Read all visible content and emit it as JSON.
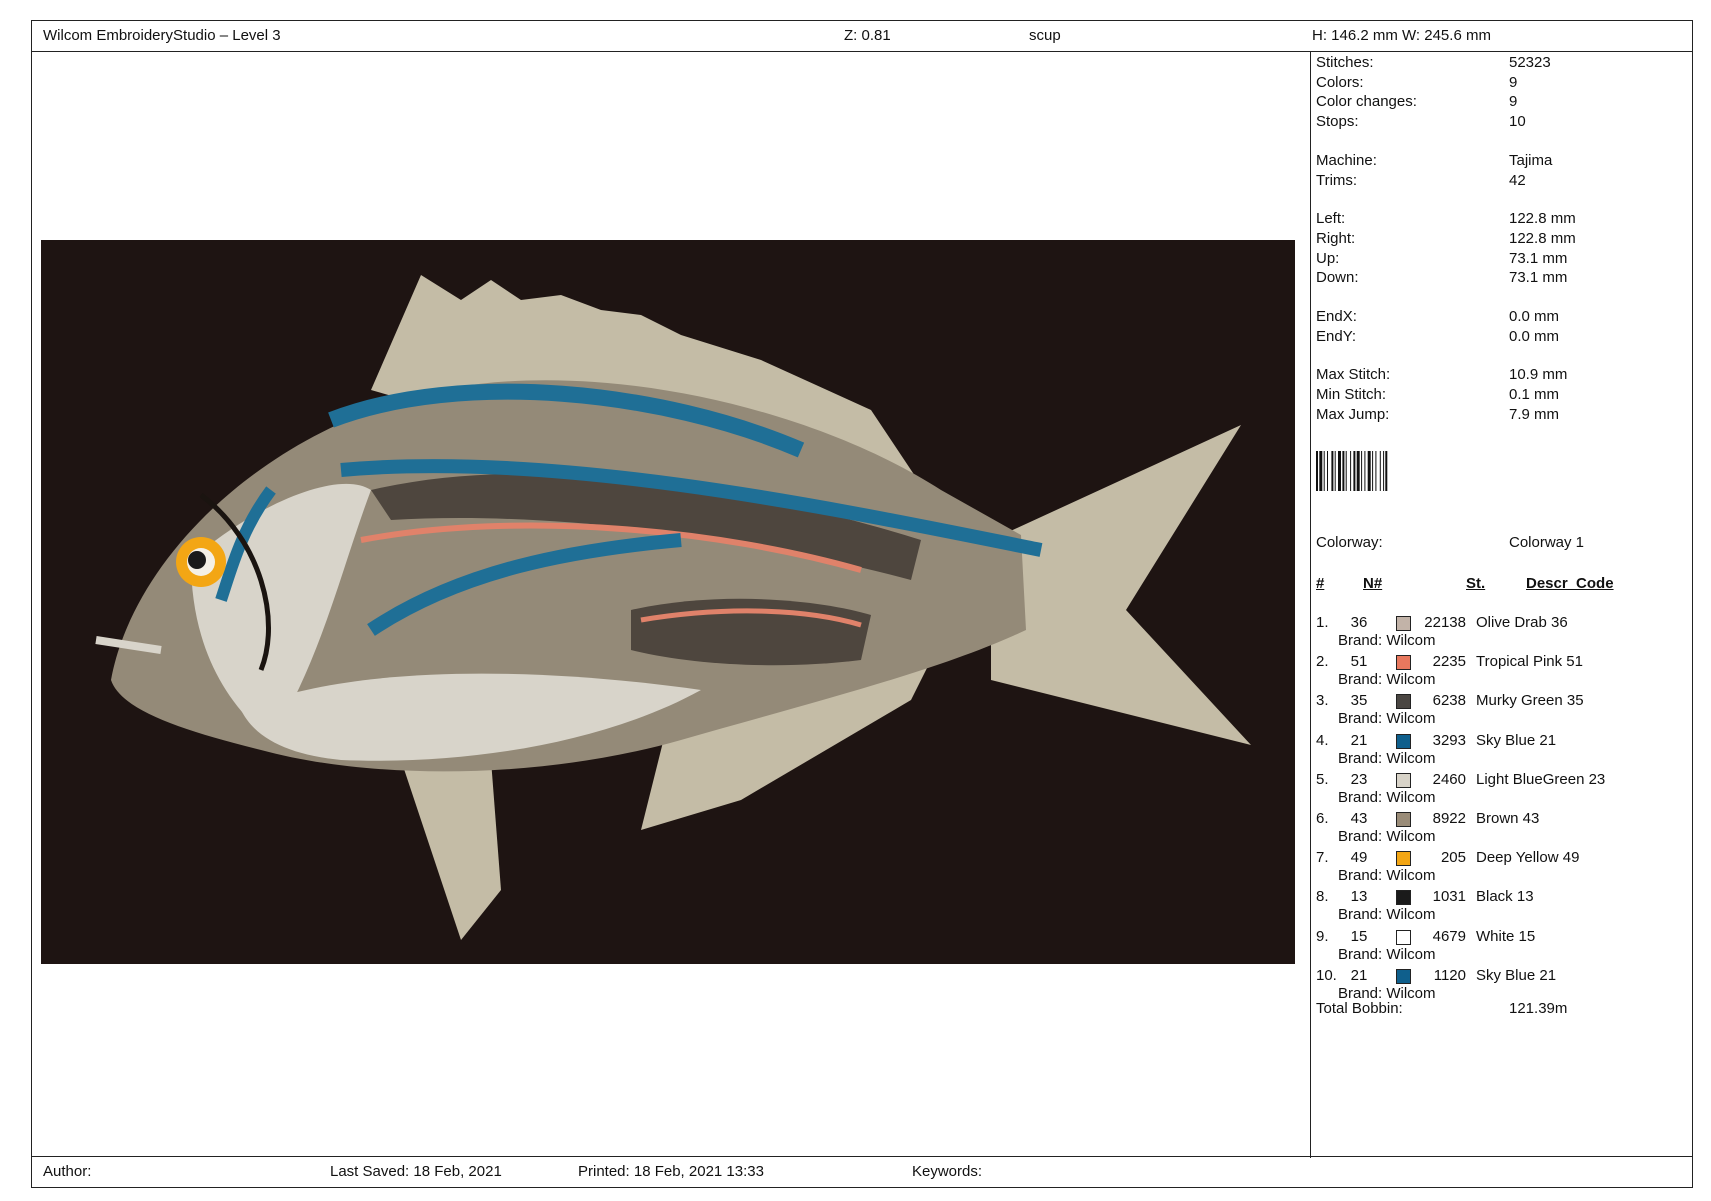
{
  "header": {
    "app_title": "Wilcom EmbroideryStudio – Level 3",
    "zoom": "Z: 0.81",
    "design_name": "scup",
    "size": "H: 146.2 mm   W: 245.6 mm"
  },
  "stats": [
    {
      "label": "Stitches:",
      "value": "52323"
    },
    {
      "label": "Colors:",
      "value": "9"
    },
    {
      "label": "Color changes:",
      "value": "9"
    },
    {
      "label": "Stops:",
      "value": "10"
    },
    {
      "label": "Machine:",
      "value": "Tajima"
    },
    {
      "label": "Trims:",
      "value": "42"
    },
    {
      "label": "Left:",
      "value": "122.8 mm"
    },
    {
      "label": "Right:",
      "value": "122.8 mm"
    },
    {
      "label": "Up:",
      "value": "73.1 mm"
    },
    {
      "label": "Down:",
      "value": "73.1 mm"
    },
    {
      "label": "EndX:",
      "value": "0.0 mm"
    },
    {
      "label": "EndY:",
      "value": "0.0 mm"
    },
    {
      "label": "Max Stitch:",
      "value": "10.9 mm"
    },
    {
      "label": "Min Stitch:",
      "value": "0.1 mm"
    },
    {
      "label": "Max Jump:",
      "value": "7.9 mm"
    }
  ],
  "colorway": {
    "label": "Colorway:",
    "value": "Colorway 1"
  },
  "color_table": {
    "headers": {
      "index": "#",
      "number": "N#",
      "stitches": "St.",
      "description": "Descr_Code"
    },
    "rows": [
      {
        "index": "1.",
        "number": "36",
        "color": "#c2b3a8",
        "stitches": "22138",
        "description": "Olive Drab 36",
        "brand": "Brand: Wilcom"
      },
      {
        "index": "2.",
        "number": "51",
        "color": "#e8785e",
        "stitches": "2235",
        "description": "Tropical Pink 51",
        "brand": "Brand: Wilcom"
      },
      {
        "index": "3.",
        "number": "35",
        "color": "#4a4642",
        "stitches": "6238",
        "description": "Murky Green 35",
        "brand": "Brand: Wilcom"
      },
      {
        "index": "4.",
        "number": "21",
        "color": "#0f5f8c",
        "stitches": "3293",
        "description": "Sky Blue 21",
        "brand": "Brand: Wilcom"
      },
      {
        "index": "5.",
        "number": "23",
        "color": "#d8d3c8",
        "stitches": "2460",
        "description": "Light BlueGreen 23",
        "brand": "Brand: Wilcom"
      },
      {
        "index": "6.",
        "number": "43",
        "color": "#9a8c78",
        "stitches": "8922",
        "description": "Brown 43",
        "brand": "Brand: Wilcom"
      },
      {
        "index": "7.",
        "number": "49",
        "color": "#f3a614",
        "stitches": "205",
        "description": "Deep Yellow 49",
        "brand": "Brand: Wilcom"
      },
      {
        "index": "8.",
        "number": "13",
        "color": "#1a1a1a",
        "stitches": "1031",
        "description": "Black 13",
        "brand": "Brand: Wilcom"
      },
      {
        "index": "9.",
        "number": "15",
        "color": "#ffffff",
        "stitches": "4679",
        "description": "White 15",
        "brand": "Brand: Wilcom"
      },
      {
        "index": "10.",
        "number": "21",
        "color": "#0f5f8c",
        "stitches": "1120",
        "description": "Sky Blue 21",
        "brand": "Brand: Wilcom"
      }
    ]
  },
  "bobbin": {
    "label": "Total Bobbin:",
    "value": "121.39m"
  },
  "footer": {
    "author": "Author:",
    "last_saved": "Last Saved: 18 Feb, 2021",
    "printed": "Printed: 18 Feb, 2021 13:33",
    "keywords": "Keywords:"
  },
  "artwork": {
    "background": "#1e1412",
    "body": "#948a78",
    "belly": "#d8d4ca",
    "stripe": "#1f6f96",
    "stripe_pink": "#e0826a",
    "dark_band": "#4e463e",
    "fin": "#c4bca6",
    "eye": "#f3a614"
  }
}
